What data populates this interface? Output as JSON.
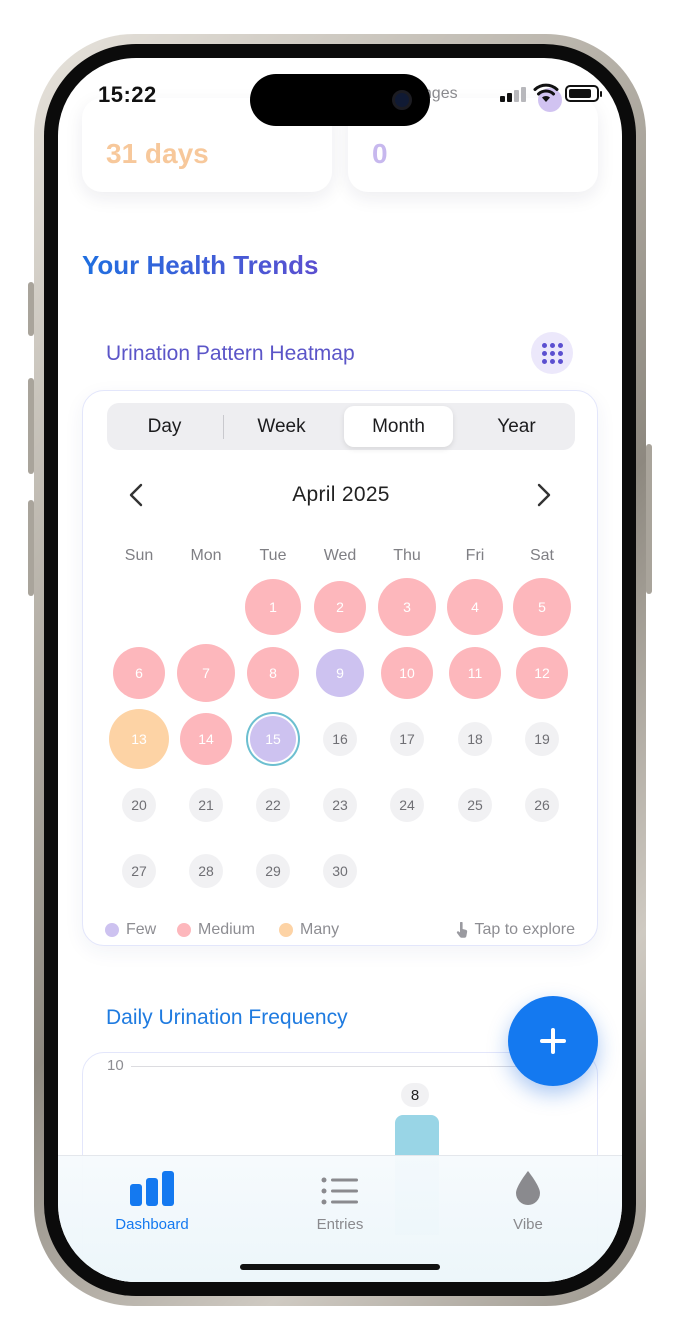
{
  "status_bar": {
    "time": "15:22",
    "underlay_text": "anges"
  },
  "stats": {
    "left_value": "31 days",
    "right_value": "0"
  },
  "section": {
    "title": "Your Health Trends"
  },
  "heatmap": {
    "title": "Urination Pattern Heatmap",
    "tabs": [
      {
        "label": "Day",
        "active": false
      },
      {
        "label": "Week",
        "active": false
      },
      {
        "label": "Month",
        "active": true
      },
      {
        "label": "Year",
        "active": false
      }
    ],
    "month_label": "April 2025",
    "weekdays": [
      "Sun",
      "Mon",
      "Tue",
      "Wed",
      "Thu",
      "Fri",
      "Sat"
    ],
    "first_weekday_index": 2,
    "days": [
      {
        "n": "1",
        "level": "medium"
      },
      {
        "n": "2",
        "level": "medium"
      },
      {
        "n": "3",
        "level": "medium"
      },
      {
        "n": "4",
        "level": "medium"
      },
      {
        "n": "5",
        "level": "medium"
      },
      {
        "n": "6",
        "level": "medium"
      },
      {
        "n": "7",
        "level": "medium"
      },
      {
        "n": "8",
        "level": "medium"
      },
      {
        "n": "9",
        "level": "few"
      },
      {
        "n": "10",
        "level": "medium"
      },
      {
        "n": "11",
        "level": "medium"
      },
      {
        "n": "12",
        "level": "medium"
      },
      {
        "n": "13",
        "level": "many"
      },
      {
        "n": "14",
        "level": "medium"
      },
      {
        "n": "15",
        "level": "few",
        "today": true
      },
      {
        "n": "16",
        "level": "empty"
      },
      {
        "n": "17",
        "level": "empty"
      },
      {
        "n": "18",
        "level": "empty"
      },
      {
        "n": "19",
        "level": "empty"
      },
      {
        "n": "20",
        "level": "empty"
      },
      {
        "n": "21",
        "level": "empty"
      },
      {
        "n": "22",
        "level": "empty"
      },
      {
        "n": "23",
        "level": "empty"
      },
      {
        "n": "24",
        "level": "empty"
      },
      {
        "n": "25",
        "level": "empty"
      },
      {
        "n": "26",
        "level": "empty"
      },
      {
        "n": "27",
        "level": "empty"
      },
      {
        "n": "28",
        "level": "empty"
      },
      {
        "n": "29",
        "level": "empty"
      },
      {
        "n": "30",
        "level": "empty"
      }
    ],
    "legend": [
      {
        "label": "Few",
        "color": "#cdc2f0"
      },
      {
        "label": "Medium",
        "color": "#fdb7bc"
      },
      {
        "label": "Many",
        "color": "#fdd3a5"
      }
    ],
    "hint": "Tap to explore"
  },
  "frequency": {
    "title": "Daily Urination Frequency",
    "axis_max_label": "10",
    "bar_value_label": "8"
  },
  "tabbar": {
    "items": [
      {
        "label": "Dashboard",
        "icon": "bar-chart-icon",
        "active": true
      },
      {
        "label": "Entries",
        "icon": "list-icon",
        "active": false
      },
      {
        "label": "Vibe",
        "icon": "drop-icon",
        "active": false
      }
    ]
  },
  "colors": {
    "accent": "#1479f0",
    "medium": "#fdb7bc",
    "few": "#cdc2f0",
    "many": "#fdd3a5"
  }
}
